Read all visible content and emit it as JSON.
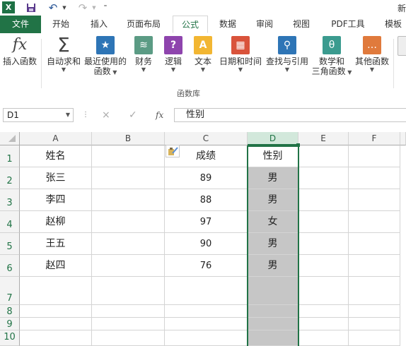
{
  "titlebar": {
    "app_icon": "X",
    "doc_title_fragment": "新"
  },
  "tabs": [
    {
      "label": "文件",
      "active": false
    },
    {
      "label": "开始",
      "active": false
    },
    {
      "label": "插入",
      "active": false
    },
    {
      "label": "页面布局",
      "active": false
    },
    {
      "label": "公式",
      "active": true
    },
    {
      "label": "数据",
      "active": false
    },
    {
      "label": "审阅",
      "active": false
    },
    {
      "label": "视图",
      "active": false
    },
    {
      "label": "PDF工具",
      "active": false
    },
    {
      "label": "模板",
      "active": false
    }
  ],
  "ribbon": {
    "buttons": [
      {
        "line1": "插入函数",
        "line2": "",
        "icon": "fx-icon"
      },
      {
        "line1": "自动求和",
        "line2": "",
        "icon": "sigma-icon"
      },
      {
        "line1": "最近使用的",
        "line2": "函数",
        "icon": "star-book-icon"
      },
      {
        "line1": "财务",
        "line2": "",
        "icon": "coins-book-icon"
      },
      {
        "line1": "逻辑",
        "line2": "",
        "icon": "question-book-icon"
      },
      {
        "line1": "文本",
        "line2": "",
        "icon": "a-book-icon"
      },
      {
        "line1": "日期和时间",
        "line2": "",
        "icon": "calendar-book-icon"
      },
      {
        "line1": "查找与引用",
        "line2": "",
        "icon": "magnifier-book-icon"
      },
      {
        "line1": "数学和",
        "line2": "三角函数",
        "icon": "theta-book-icon"
      },
      {
        "line1": "其他函数",
        "line2": "",
        "icon": "dots-book-icon"
      }
    ],
    "group_label": "函数库",
    "colors": {
      "orange": "#e07a3c",
      "blue": "#2e75b6",
      "green": "#4caf7a",
      "purple": "#8e44ad",
      "yellow": "#f2b632",
      "red": "#d9533b",
      "teal": "#3b9b8f"
    }
  },
  "formula_bar": {
    "name_box": "D1",
    "cancel_icon": "×",
    "enter_icon": "✓",
    "fx_label": "fx",
    "value": "性别"
  },
  "grid": {
    "columns": [
      "A",
      "B",
      "C",
      "D",
      "E",
      "F"
    ],
    "rows": [
      "1",
      "2",
      "3",
      "4",
      "5",
      "6",
      "7",
      "8",
      "9",
      "10"
    ],
    "data": [
      [
        "姓名",
        "",
        "成绩",
        "性别"
      ],
      [
        "张三",
        "",
        "89",
        "男"
      ],
      [
        "李四",
        "",
        "88",
        "男"
      ],
      [
        "赵柳",
        "",
        "97",
        "女"
      ],
      [
        "王五",
        "",
        "90",
        "男"
      ],
      [
        "赵四",
        "",
        "76",
        "男"
      ]
    ],
    "selected_column": "D",
    "accent": "#217346"
  }
}
